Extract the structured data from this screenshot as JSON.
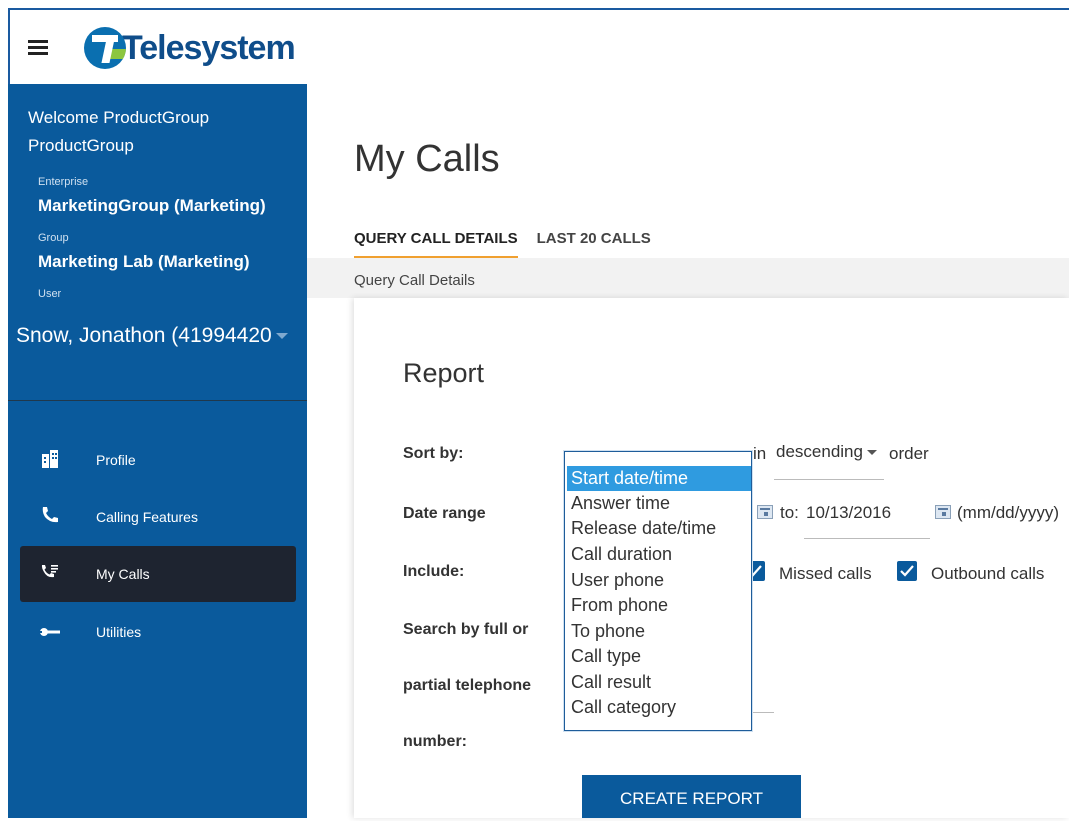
{
  "header": {
    "brand": "Telesystem"
  },
  "sidebar": {
    "welcome": "Welcome ProductGroup ProductGroup",
    "enterprise_label": "Enterprise",
    "enterprise_value": "MarketingGroup (Marketing)",
    "group_label": "Group",
    "group_value": "Marketing Lab (Marketing)",
    "user_label": "User",
    "user_value": "Snow, Jonathon (41994420",
    "items": [
      {
        "label": "Profile",
        "icon": "building-icon"
      },
      {
        "label": "Calling Features",
        "icon": "phone-forward-icon"
      },
      {
        "label": "My Calls",
        "icon": "call-log-icon"
      },
      {
        "label": "Utilities",
        "icon": "wrench-icon"
      }
    ]
  },
  "main": {
    "title": "My Calls",
    "tabs": [
      {
        "label": "QUERY CALL DETAILS"
      },
      {
        "label": "LAST 20 CALLS"
      }
    ],
    "subtitle": "Query Call Details",
    "report_title": "Report",
    "labels": {
      "sort_by": "Sort by:",
      "date_range": "Date range",
      "include": "Include:",
      "search_1": "Search by full or",
      "search_2": "partial telephone",
      "search_3": "number:"
    },
    "sort": {
      "hidden_value": "Start date/time",
      "in_text": "in",
      "order_value": "descending",
      "order_text": "order"
    },
    "date": {
      "to_label": "to:",
      "to_value": "10/13/2016",
      "format": "(mm/dd/yyyy)"
    },
    "include": {
      "missed": "Missed calls",
      "outbound": "Outbound calls"
    },
    "sort_options": [
      "Start date/time",
      "Answer time",
      "Release date/time",
      "Call duration",
      "User phone",
      "From phone",
      "To phone",
      "Call type",
      "Call result",
      "Call category"
    ],
    "button": "CREATE REPORT"
  },
  "colors": {
    "brand_blue": "#0a5a9c",
    "tab_accent": "#f0a030",
    "selection": "#2f9be0"
  }
}
